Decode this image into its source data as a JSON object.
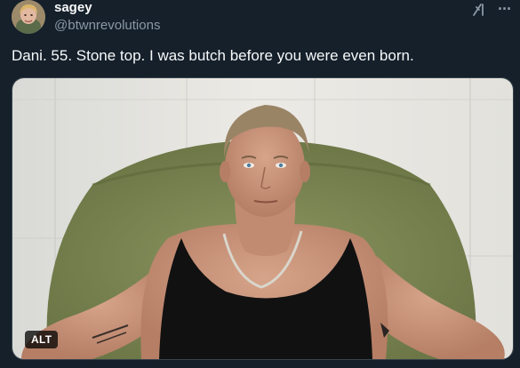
{
  "author": {
    "display_name": "sagey",
    "handle": "@btwnrevolutions"
  },
  "icons": {
    "grok": "grok-icon",
    "more": "more-icon",
    "more_glyph": "···"
  },
  "tweet": {
    "text": "Dani. 55. Stone top. I was butch before you were even born."
  },
  "media": {
    "alt_label": "ALT"
  },
  "colors": {
    "background": "#15202b",
    "text_primary": "#f7f9f9",
    "text_secondary": "#8b98a5",
    "border": "#38444d"
  }
}
